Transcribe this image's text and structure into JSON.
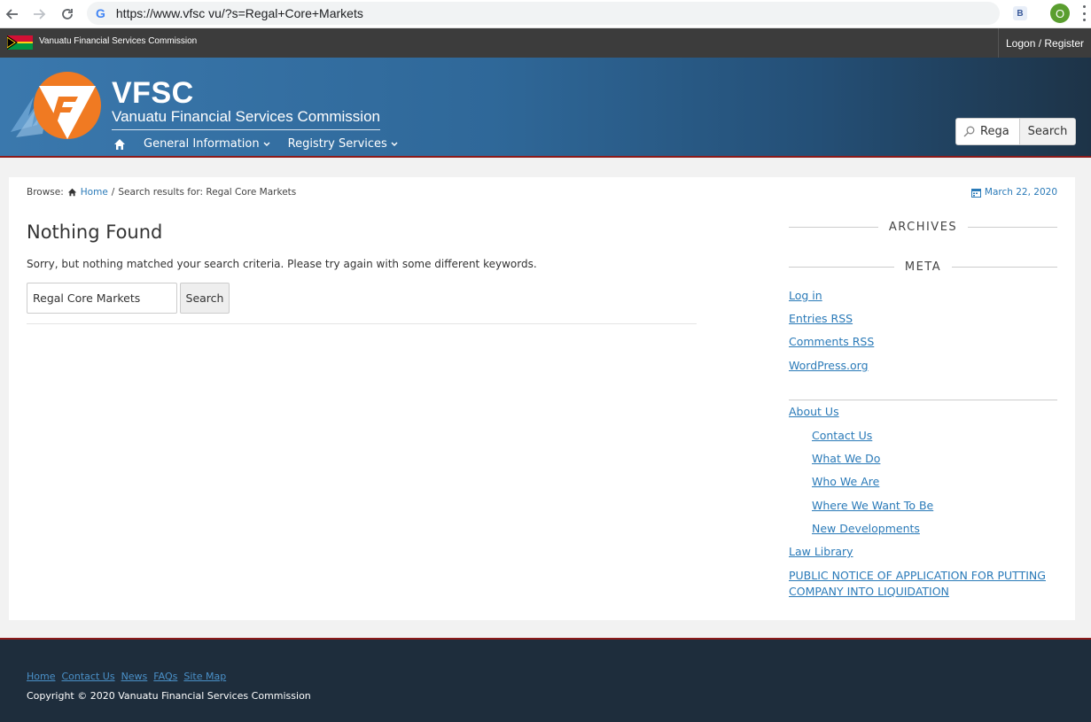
{
  "browser": {
    "url": "https://www.vfsc vu/?s=Regal+Core+Markets",
    "google_glyph": "G",
    "extension_label": "B",
    "profile_initial": "O"
  },
  "topbar": {
    "site_name": "Vanuatu Financial Services Commission",
    "logon_label": "Logon / Register"
  },
  "header": {
    "brand": "VFSC",
    "brand_sub": "Vanuatu Financial Services Commission",
    "nav": {
      "general_information": "General Information",
      "registry_services": "Registry Services"
    },
    "search": {
      "value": "Rega",
      "button": "Search"
    }
  },
  "breadcrumb": {
    "browse_label": "Browse:",
    "home_label": "Home",
    "separator": "/",
    "current": "Search results for: Regal Core Markets"
  },
  "date": "March 22, 2020",
  "main": {
    "title": "Nothing Found",
    "message": "Sorry, but nothing matched your search criteria. Please try again with some different keywords.",
    "search_value": "Regal Core Markets",
    "search_button": "Search"
  },
  "sidebar": {
    "archives_title": "ARCHIVES",
    "meta_title": "META",
    "meta_links": [
      "Log in",
      "Entries RSS",
      "Comments RSS",
      "WordPress.org"
    ],
    "pages": [
      {
        "label": "About Us",
        "level": 0
      },
      {
        "label": "Contact Us",
        "level": 1
      },
      {
        "label": "What We Do",
        "level": 1
      },
      {
        "label": "Who We Are",
        "level": 1
      },
      {
        "label": "Where We Want To Be",
        "level": 1
      },
      {
        "label": "New Developments",
        "level": 1
      },
      {
        "label": "Law Library",
        "level": 0
      },
      {
        "label": "PUBLIC NOTICE OF APPLICATION FOR PUTTING COMPANY INTO LIQUIDATION",
        "level": 0
      }
    ]
  },
  "footer": {
    "links": [
      "Home",
      "Contact Us",
      "News",
      "FAQs",
      "Site Map"
    ],
    "copyright": "Copyright © 2020 Vanuatu Financial Services Commission"
  },
  "colors": {
    "topbar": "#3c3c3c",
    "header_start": "#3a78ad",
    "header_end": "#1d3347",
    "accent_red": "#8b1a1a",
    "link": "#2a7ab8",
    "footer_bg": "#1e2d3c",
    "logo_orange": "#f07a22"
  }
}
